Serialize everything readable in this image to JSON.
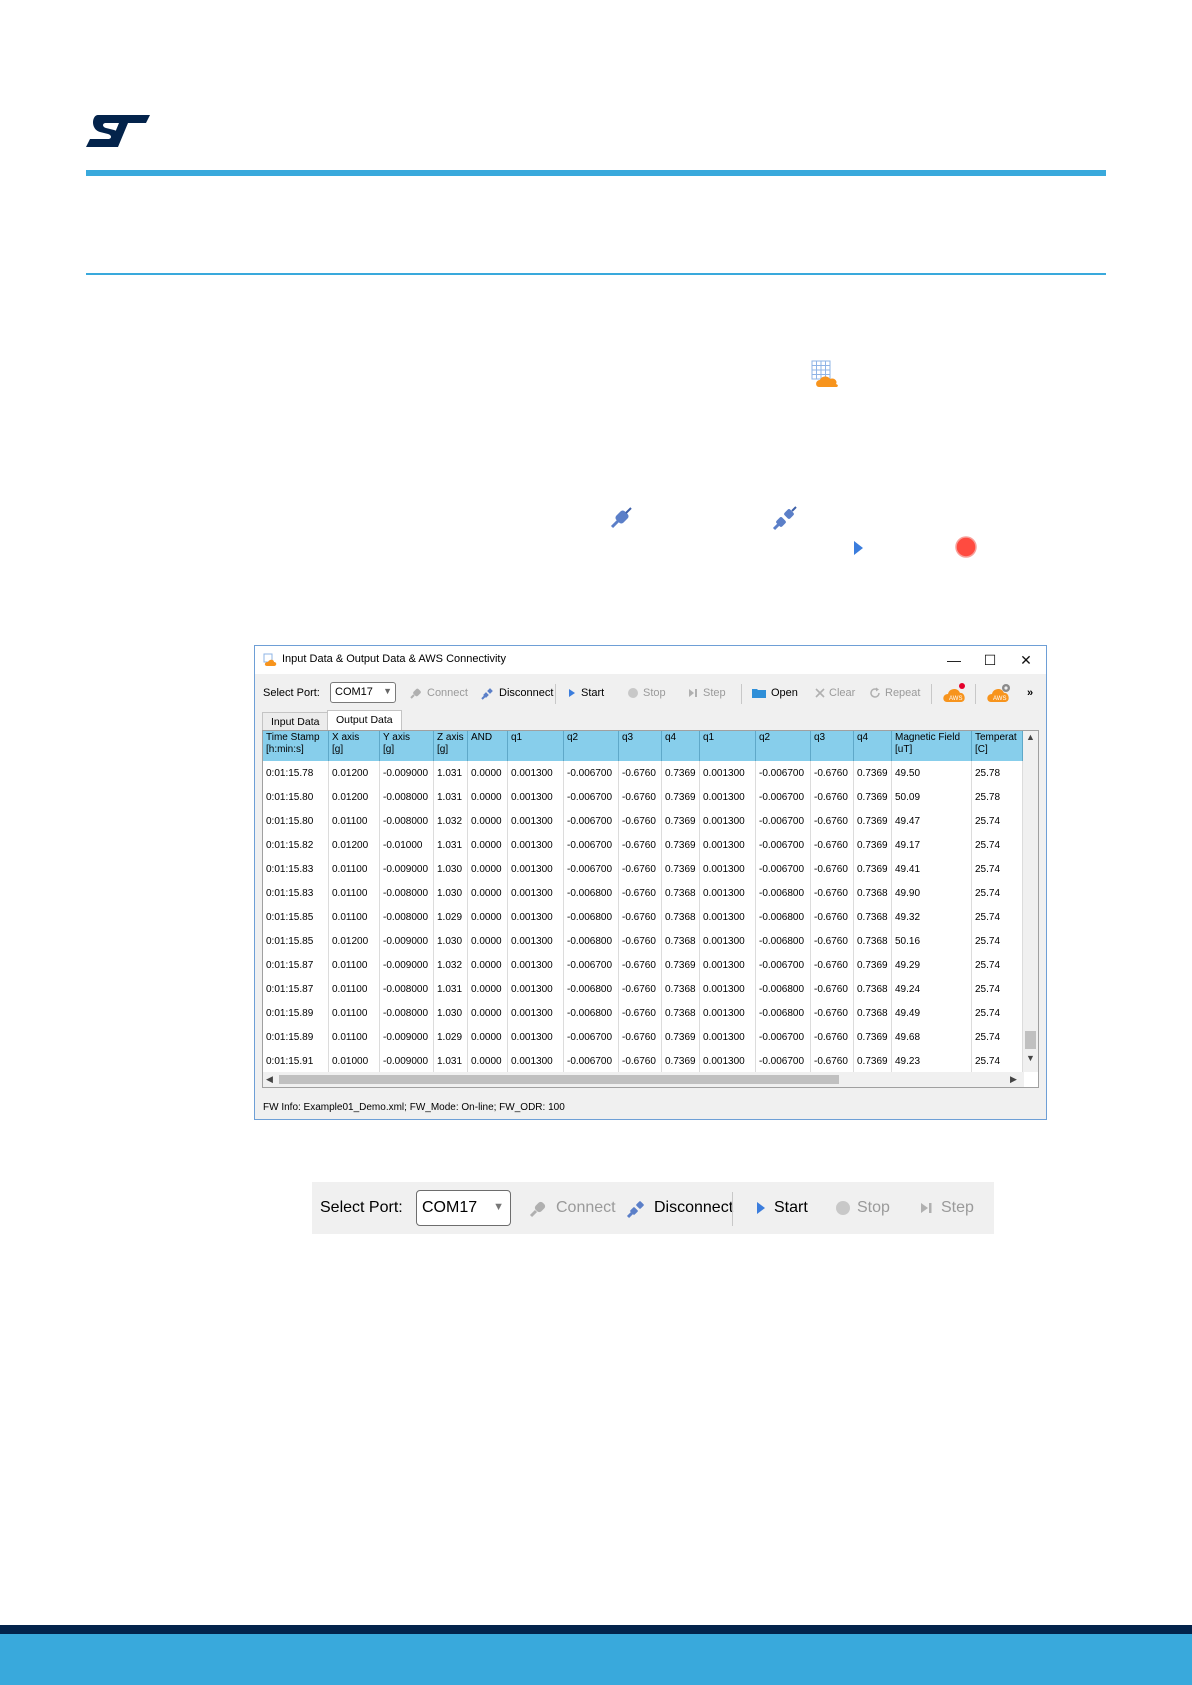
{
  "window": {
    "title": "Input Data & Output Data & AWS Connectivity",
    "controls": {
      "minimize": "—",
      "maximize": "☐",
      "close": "✕"
    }
  },
  "toolbar": {
    "port_label": "Select Port:",
    "port_value": "COM17",
    "connect_label": "Connect",
    "disconnect_label": "Disconnect",
    "start_label": "Start",
    "stop_label": "Stop",
    "step_label": "Step",
    "open_label": "Open",
    "clear_label": "Clear",
    "repeat_label": "Repeat",
    "aws_label": "AWS",
    "overflow_label": "»"
  },
  "tabs": {
    "input": "Input Data",
    "output": "Output Data"
  },
  "table": {
    "headers": [
      [
        "Time Stamp",
        "[h:min:s]"
      ],
      [
        "X axis",
        "[g]"
      ],
      [
        "Y axis",
        "[g]"
      ],
      [
        "Z axis",
        "[g]"
      ],
      [
        "AND",
        ""
      ],
      [
        "q1",
        ""
      ],
      [
        "q2",
        ""
      ],
      [
        "q3",
        ""
      ],
      [
        "q4",
        ""
      ],
      [
        "q1",
        ""
      ],
      [
        "q2",
        ""
      ],
      [
        "q3",
        ""
      ],
      [
        "q4",
        ""
      ],
      [
        "Magnetic Field",
        "[uT]"
      ],
      [
        "Temperat",
        "[C]"
      ]
    ],
    "rows": [
      [
        "0:01:15.78",
        "0.01200",
        "-0.009000",
        "1.031",
        "0.0000",
        "0.001300",
        "-0.006700",
        "-0.6760",
        "0.7369",
        "0.001300",
        "-0.006700",
        "-0.6760",
        "0.7369",
        "49.50",
        "25.78"
      ],
      [
        "0:01:15.80",
        "0.01200",
        "-0.008000",
        "1.031",
        "0.0000",
        "0.001300",
        "-0.006700",
        "-0.6760",
        "0.7369",
        "0.001300",
        "-0.006700",
        "-0.6760",
        "0.7369",
        "50.09",
        "25.78"
      ],
      [
        "0:01:15.80",
        "0.01100",
        "-0.008000",
        "1.032",
        "0.0000",
        "0.001300",
        "-0.006700",
        "-0.6760",
        "0.7369",
        "0.001300",
        "-0.006700",
        "-0.6760",
        "0.7369",
        "49.47",
        "25.74"
      ],
      [
        "0:01:15.82",
        "0.01200",
        "-0.01000",
        "1.031",
        "0.0000",
        "0.001300",
        "-0.006700",
        "-0.6760",
        "0.7369",
        "0.001300",
        "-0.006700",
        "-0.6760",
        "0.7369",
        "49.17",
        "25.74"
      ],
      [
        "0:01:15.83",
        "0.01100",
        "-0.009000",
        "1.030",
        "0.0000",
        "0.001300",
        "-0.006700",
        "-0.6760",
        "0.7369",
        "0.001300",
        "-0.006700",
        "-0.6760",
        "0.7369",
        "49.41",
        "25.74"
      ],
      [
        "0:01:15.83",
        "0.01100",
        "-0.008000",
        "1.030",
        "0.0000",
        "0.001300",
        "-0.006800",
        "-0.6760",
        "0.7368",
        "0.001300",
        "-0.006800",
        "-0.6760",
        "0.7368",
        "49.90",
        "25.74"
      ],
      [
        "0:01:15.85",
        "0.01100",
        "-0.008000",
        "1.029",
        "0.0000",
        "0.001300",
        "-0.006800",
        "-0.6760",
        "0.7368",
        "0.001300",
        "-0.006800",
        "-0.6760",
        "0.7368",
        "49.32",
        "25.74"
      ],
      [
        "0:01:15.85",
        "0.01200",
        "-0.009000",
        "1.030",
        "0.0000",
        "0.001300",
        "-0.006800",
        "-0.6760",
        "0.7368",
        "0.001300",
        "-0.006800",
        "-0.6760",
        "0.7368",
        "50.16",
        "25.74"
      ],
      [
        "0:01:15.87",
        "0.01100",
        "-0.009000",
        "1.032",
        "0.0000",
        "0.001300",
        "-0.006700",
        "-0.6760",
        "0.7369",
        "0.001300",
        "-0.006700",
        "-0.6760",
        "0.7369",
        "49.29",
        "25.74"
      ],
      [
        "0:01:15.87",
        "0.01100",
        "-0.008000",
        "1.031",
        "0.0000",
        "0.001300",
        "-0.006800",
        "-0.6760",
        "0.7368",
        "0.001300",
        "-0.006800",
        "-0.6760",
        "0.7368",
        "49.24",
        "25.74"
      ],
      [
        "0:01:15.89",
        "0.01100",
        "-0.008000",
        "1.030",
        "0.0000",
        "0.001300",
        "-0.006800",
        "-0.6760",
        "0.7368",
        "0.001300",
        "-0.006800",
        "-0.6760",
        "0.7368",
        "49.49",
        "25.74"
      ],
      [
        "0:01:15.89",
        "0.01100",
        "-0.009000",
        "1.029",
        "0.0000",
        "0.001300",
        "-0.006700",
        "-0.6760",
        "0.7369",
        "0.001300",
        "-0.006700",
        "-0.6760",
        "0.7369",
        "49.68",
        "25.74"
      ],
      [
        "0:01:15.91",
        "0.01000",
        "-0.009000",
        "1.031",
        "0.0000",
        "0.001300",
        "-0.006700",
        "-0.6760",
        "0.7369",
        "0.001300",
        "-0.006700",
        "-0.6760",
        "0.7369",
        "49.23",
        "25.74"
      ]
    ]
  },
  "status_bar": "FW Info: Example01_Demo.xml; FW_Mode: On-line; FW_ODR: 100",
  "zoomed_toolbar": {
    "port_label": "Select Port:",
    "port_value": "COM17",
    "connect_label": "Connect",
    "disconnect_label": "Disconnect",
    "start_label": "Start",
    "stop_label": "Stop",
    "step_label": "Step"
  },
  "colors": {
    "st_blue": "#39a9dc",
    "st_navy": "#03234b",
    "header_blue": "#87ceeb",
    "aws_orange": "#f7941d"
  },
  "icons": [
    "st-logo",
    "grid-cloud-icon",
    "connect-plug-icon",
    "disconnect-plug-icon",
    "start-triangle-icon",
    "record-dot-icon",
    "aws-cloud-icon",
    "aws-settings-icon"
  ]
}
